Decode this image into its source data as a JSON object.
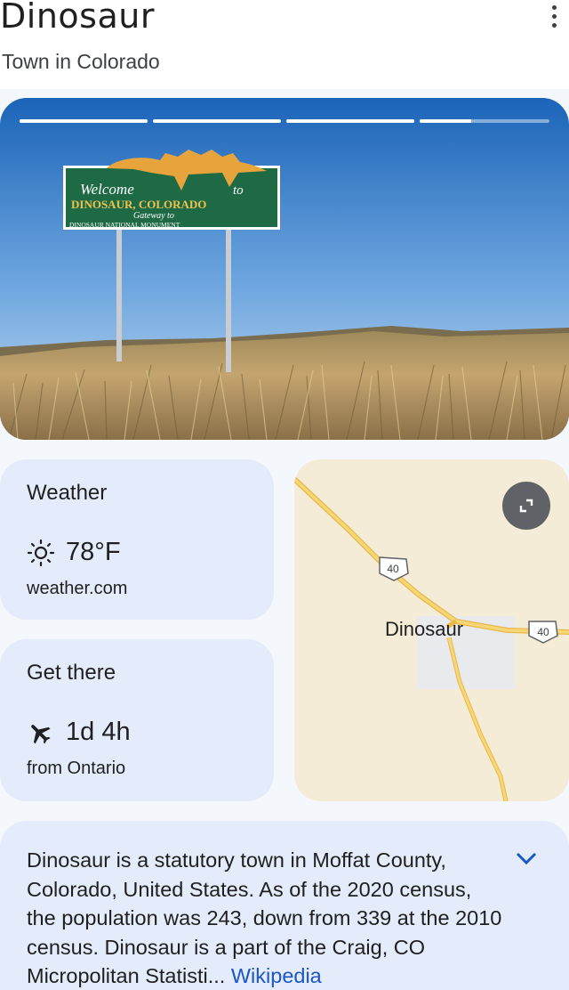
{
  "header": {
    "title": "Dinosaur",
    "subtitle": "Town in Colorado",
    "more_icon": "more-vert-icon"
  },
  "hero": {
    "story_progress": [
      1,
      1,
      1,
      0.4
    ],
    "sign": {
      "line1a": "Welcome",
      "line1b": "to",
      "line2": "DINOSAUR, COLORADO",
      "line3": "Gateway to",
      "line4": "DINOSAUR NATIONAL MONUMENT"
    },
    "colors": {
      "sky_top": "#1d6fc4",
      "sky_bottom": "#b8d3ee",
      "sign": "#1e6a45",
      "grass": "#b99a62"
    }
  },
  "weather": {
    "heading": "Weather",
    "icon": "sun-icon",
    "temperature": "78°F",
    "source": "weather.com"
  },
  "get_there": {
    "heading": "Get there",
    "icon": "airplane-icon",
    "duration": "1d 4h",
    "origin": "from Ontario"
  },
  "map": {
    "place_label": "Dinosaur",
    "route_shield_1": "40",
    "route_shield_2": "40",
    "expand_icon": "expand-icon",
    "colors": {
      "land": "#f5ecd8",
      "road": "#f5c542",
      "town": "#e8eaee"
    }
  },
  "description": {
    "text": "Dinosaur is a statutory town in Moffat County, Colorado, United States. As of the 2020 census, the population was 243, down from 339 at the 2010 census. Dinosaur is a part of the Craig, CO Micropolitan Statisti",
    "ellipsis": "...",
    "link": "Wikipedia",
    "expand_icon": "chevron-down-icon",
    "link_color": "#1a56c4"
  }
}
